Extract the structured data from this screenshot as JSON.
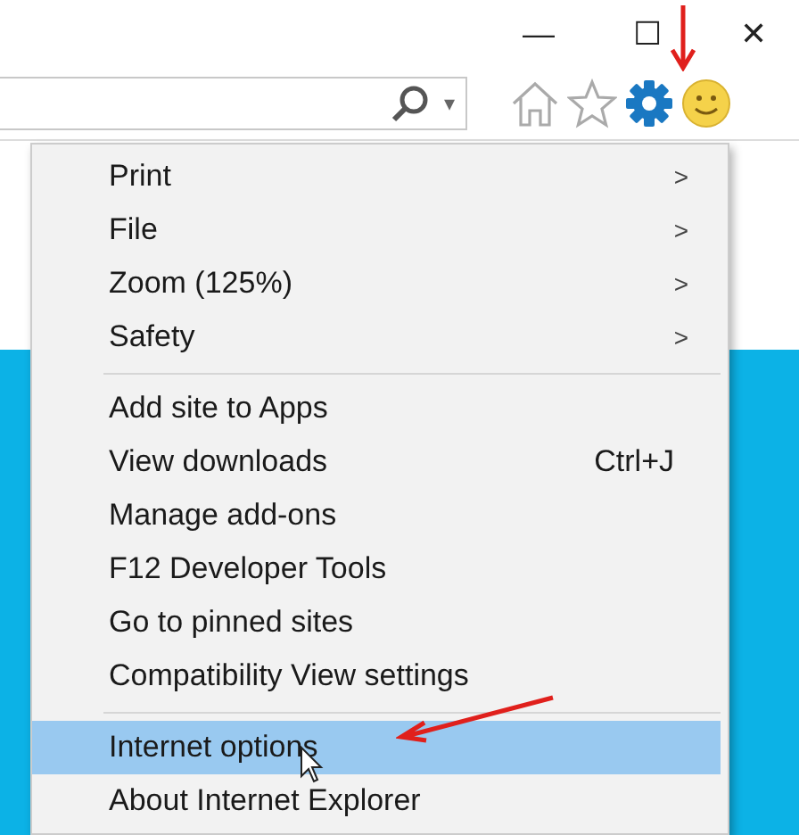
{
  "window_controls": {
    "minimize": "—",
    "maximize": "☐",
    "close": "✕"
  },
  "toolbar": {
    "search_dropdown": "▾"
  },
  "menu": {
    "groups": [
      [
        {
          "label": "Print",
          "submenu": true,
          "selected": false
        },
        {
          "label": "File",
          "submenu": true,
          "selected": false
        },
        {
          "label": "Zoom (125%)",
          "submenu": true,
          "selected": false
        },
        {
          "label": "Safety",
          "submenu": true,
          "selected": false
        }
      ],
      [
        {
          "label": "Add site to Apps",
          "submenu": false,
          "selected": false
        },
        {
          "label": "View downloads",
          "shortcut": "Ctrl+J",
          "submenu": false,
          "selected": false
        },
        {
          "label": "Manage add-ons",
          "submenu": false,
          "selected": false
        },
        {
          "label": "F12 Developer Tools",
          "submenu": false,
          "selected": false
        },
        {
          "label": "Go to pinned sites",
          "submenu": false,
          "selected": false
        },
        {
          "label": "Compatibility View settings",
          "submenu": false,
          "selected": false
        }
      ],
      [
        {
          "label": "Internet options",
          "submenu": false,
          "selected": true
        },
        {
          "label": "About Internet Explorer",
          "submenu": false,
          "selected": false
        }
      ]
    ],
    "submenu_arrow": ">"
  }
}
